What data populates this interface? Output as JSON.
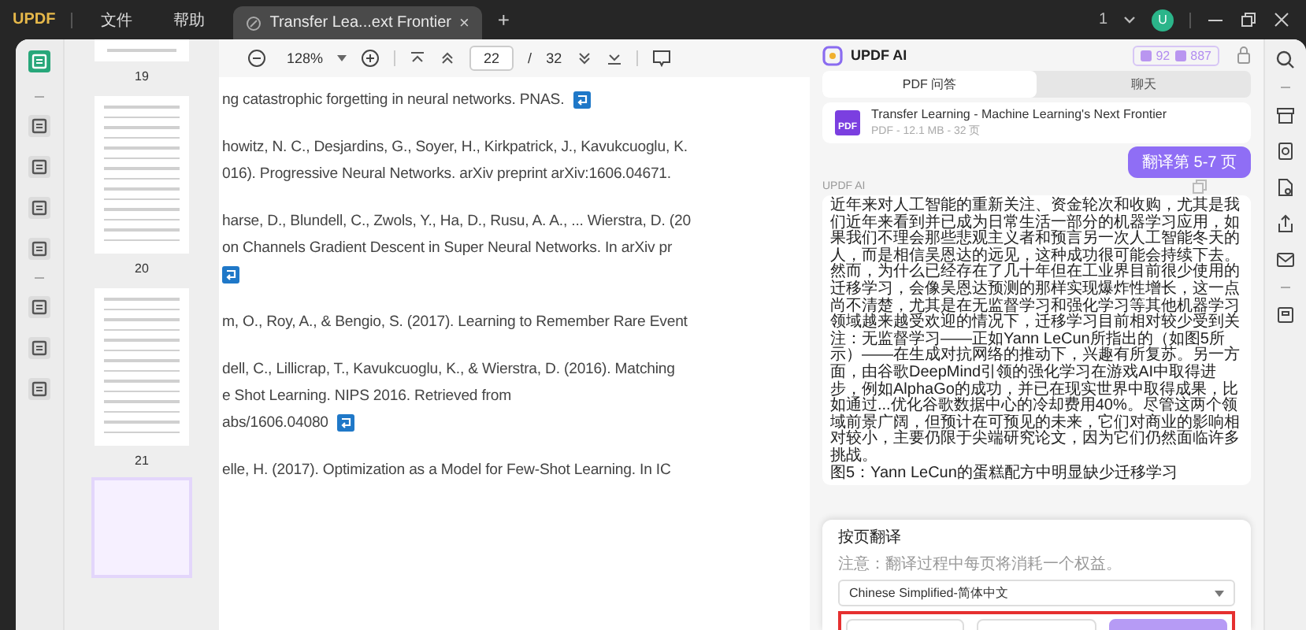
{
  "app": {
    "logo": "UPDF",
    "menus": [
      "文件",
      "帮助"
    ]
  },
  "tabs": [
    {
      "title": "Transfer Lea...ext Frontier",
      "close": "×",
      "selected": true
    }
  ],
  "new_tab": "+",
  "window_count": "1",
  "avatar": "U",
  "left_tools": [
    {
      "selected": true
    },
    {
      "selected": false
    },
    {
      "selected": false
    },
    {
      "selected": false
    },
    {
      "selected": false
    },
    {
      "selected": false
    },
    {
      "selected": false
    },
    {
      "selected": false
    }
  ],
  "thumbnails": [
    {
      "page": "19",
      "selected": false,
      "kind": "top"
    },
    {
      "page": "20",
      "selected": false,
      "kind": "full"
    },
    {
      "page": "21",
      "selected": false,
      "kind": "full"
    },
    {
      "selected": true,
      "kind": "partial"
    }
  ],
  "toolbar": {
    "zoom": "128%",
    "page": "22",
    "separator": "/",
    "total": "32"
  },
  "references": [
    {
      "lines": [
        {
          "text": "ng catastrophic forgetting in neural networks. PNAS.",
          "link": true
        }
      ]
    },
    {
      "lines": [
        {
          "text": "howitz, N. C., Desjardins, G., Soyer, H., Kirkpatrick, J., Kavukcuoglu, K.",
          "link": false
        },
        {
          "text": "016). Progressive Neural Networks. arXiv preprint arXiv:1606.04671.",
          "link": false
        }
      ]
    },
    {
      "lines": [
        {
          "text": "harse, D., Blundell, C., Zwols, Y., Ha, D., Rusu, A. A., ... Wierstra, D. (20",
          "link": false
        },
        {
          "text": "on Channels Gradient Descent in Super Neural Networks. In arXiv pr",
          "link": false
        },
        {
          "link": true
        }
      ]
    },
    {
      "lines": [
        {
          "text": "m, O., Roy, A., & Bengio, S. (2017). Learning to Remember Rare Event",
          "link": false
        }
      ]
    },
    {
      "lines": [
        {
          "text": "dell, C., Lillicrap, T., Kavukcuoglu, K., & Wierstra, D. (2016). Matching",
          "link": false
        },
        {
          "text": "e Shot Learning. NIPS 2016. Retrieved from",
          "link": false
        },
        {
          "text": "abs/1606.04080",
          "link": true
        }
      ]
    },
    {
      "lines": [
        {
          "text": "elle, H. (2017). Optimization as a Model for Few-Shot Learning. In IC",
          "link": false
        }
      ]
    }
  ],
  "ai": {
    "title": "UPDF AI",
    "credits": [
      "92",
      "887"
    ],
    "tabs": [
      {
        "label": "PDF 问答",
        "selected": true
      },
      {
        "label": "聊天",
        "selected": false
      }
    ],
    "file": {
      "icon_label": "PDF",
      "name": "Transfer Learning - Machine Learning's Next Frontier",
      "meta": "PDF - 12.1 MB - 32 页"
    },
    "messages": [
      {
        "kind": "user",
        "text": "翻译第 5-7 页"
      },
      {
        "kind": "ai",
        "sender": "UPDF AI",
        "paragraphs": [
          "近年来对人工智能的重新关注、资金轮次和收购，尤其是我们近年来看到并已成为日常生活一部分的机器学习应用，如果我们不理会那些悲观主义者和预言另一次人工智能冬天的人，而是相信吴恩达的远见，这种成功很可能会持续下去。",
          "然而，为什么已经存在了几十年但在工业界目前很少使用的迁移学习，会像吴恩达预测的那样实现爆炸性增长，这一点尚不清楚，尤其是在无监督学习和强化学习等其他机器学习领域越来越受欢迎的情况下，迁移学习目前相对较少受到关注：无监督学习——正如Yann LeCun所指出的（如图5所示）——在生成对抗网络的推动下，兴趣有所复苏。另一方面，由谷歌DeepMind引领的强化学习在游戏AI中取得进步，例如AlphaGo的成功，并已在现实世界中取得成果，比如通过...优化谷歌数据中心的冷却费用40%。尽管这两个领域前景广阔，但预计在可预见的未来，它们对商业的影响相对较小，主要仍限于尖端研究论文，因为它们仍然面临许多挑战。",
          "图5：Yann LeCun的蛋糕配方中明显缺少迁移学习"
        ]
      }
    ]
  },
  "translate_popup": {
    "title": "按页翻译",
    "note": "注意：翻译过程中每页将消耗一个权益。",
    "language": "Chinese Simplified-简体中文"
  },
  "right_tools": [
    {
      "kind": "search"
    },
    {
      "kind": "gap"
    },
    {
      "kind": "box"
    },
    {
      "kind": "doc"
    },
    {
      "kind": "file"
    },
    {
      "kind": "share"
    },
    {
      "kind": "mail"
    },
    {
      "kind": "gap"
    },
    {
      "kind": "save"
    }
  ]
}
